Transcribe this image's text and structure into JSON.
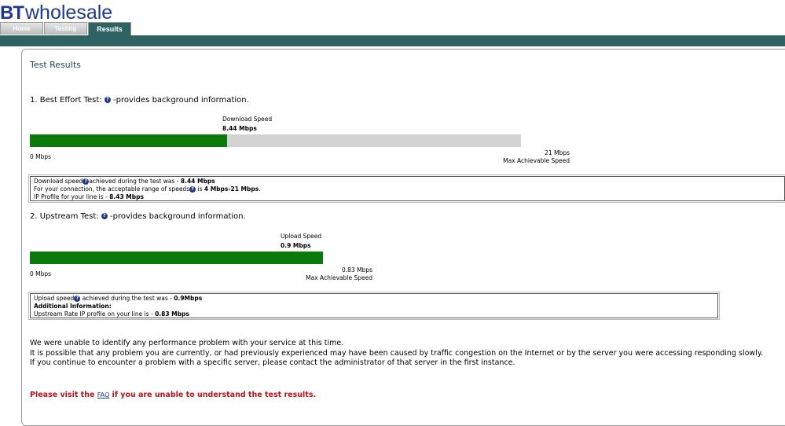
{
  "header": {
    "logo_bt": "BT",
    "logo_wholesale": "wholesale"
  },
  "tabs": [
    {
      "label": "Home",
      "active": false
    },
    {
      "label": "Testing",
      "active": false
    },
    {
      "label": "Results",
      "active": true
    }
  ],
  "page_title": "Test Results",
  "best_effort": {
    "heading": "1. Best Effort Test:",
    "heading_suffix": "-provides background information.",
    "bar_caption": "Download  Speed",
    "bar_value": "8.44 Mbps",
    "min_label": "0 Mbps",
    "max_value": "21 Mbps",
    "max_caption": "Max Achievable Speed",
    "speed_mbps": 8.44,
    "max_mbps": 21,
    "info": {
      "line1_pre": "Download speed",
      "line1_mid": "achieved during the test was - ",
      "line1_val": "8.44 Mbps",
      "line2_pre": "For your connection, the acceptable range of speeds",
      "line2_mid": " is ",
      "line2_val": "4 Mbps-21 Mbps",
      "line2_end": ".",
      "line3_pre": "IP Profile for your line is - ",
      "line3_val": "8.43 Mbps"
    }
  },
  "upstream": {
    "heading": "2. Upstream Test:",
    "heading_suffix": "-provides background information.",
    "bar_caption": "Upload Speed",
    "bar_value": "0.9 Mbps",
    "min_label": "0 Mbps",
    "max_value": "0.83 Mbps",
    "max_caption": "Max Achievable Speed",
    "speed_mbps": 0.9,
    "max_mbps": 0.83,
    "info": {
      "line1_pre": "Upload speed",
      "line1_mid": " achieved during the test was - ",
      "line1_val": "0.9Mbps",
      "line2": "Additional Information:",
      "line3_pre": "Upstream Rate IP profile on your line is - ",
      "line3_val": "0.83 Mbps"
    }
  },
  "message": {
    "line1": "We were unable to identify any performance problem with your service at this time.",
    "line2": "It is possible that any problem you are currently, or had previously experienced may have been caused by traffic congestion on the Internet or by the server you were accessing responding slowly.",
    "line3": "If you continue to encounter a problem with a specific server, please contact the administrator of that server in the first instance."
  },
  "faq": {
    "pre": "Please visit the ",
    "link": "FAQ",
    "post": " if you are unable to understand the test results."
  },
  "help_icon": "?",
  "colors": {
    "teal": "#2e6263",
    "bar_green": "#0b7a0b",
    "bar_grey": "#d3d3d3",
    "brand_blue": "#1f3a8a",
    "faq_red": "#b5121b"
  }
}
